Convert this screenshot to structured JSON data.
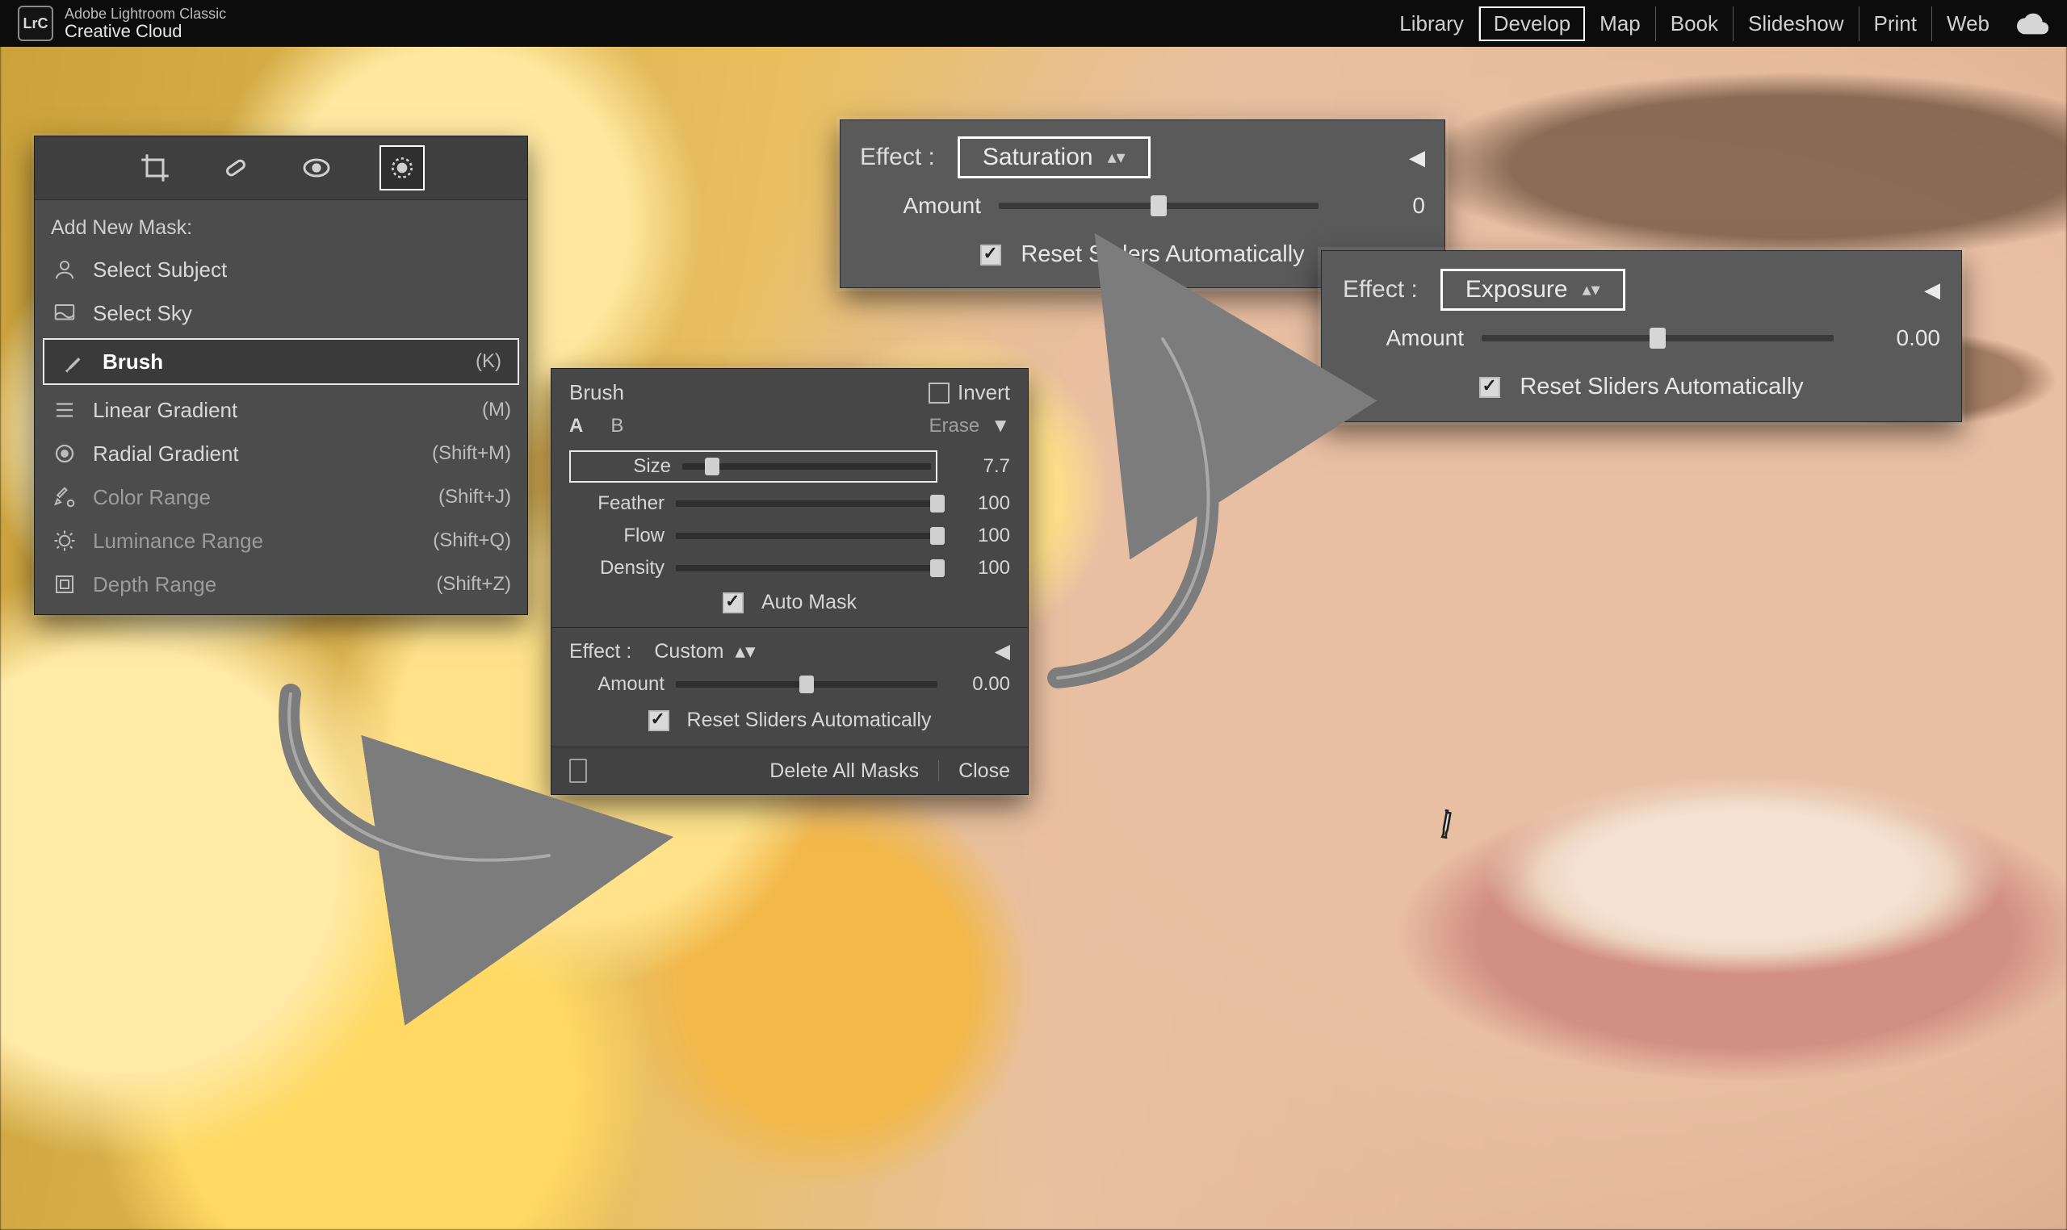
{
  "app": {
    "badge": "LrC",
    "title_line1": "Adobe Lightroom Classic",
    "title_line2": "Creative Cloud"
  },
  "modules": {
    "items": [
      "Library",
      "Develop",
      "Map",
      "Book",
      "Slideshow",
      "Print",
      "Web"
    ],
    "active": "Develop"
  },
  "mask_panel": {
    "header": "Add New Mask:",
    "rows": [
      {
        "icon": "person-icon",
        "label": "Select Subject",
        "shortcut": "",
        "dim": false
      },
      {
        "icon": "sky-icon",
        "label": "Select Sky",
        "shortcut": "",
        "dim": false
      },
      {
        "icon": "brush-icon",
        "label": "Brush",
        "shortcut": "(K)",
        "dim": false,
        "selected": true
      },
      {
        "icon": "linear-icon",
        "label": "Linear Gradient",
        "shortcut": "(M)",
        "dim": false
      },
      {
        "icon": "radial-icon",
        "label": "Radial Gradient",
        "shortcut": "(Shift+M)",
        "dim": false
      },
      {
        "icon": "colorrange-icon",
        "label": "Color Range",
        "shortcut": "(Shift+J)",
        "dim": true
      },
      {
        "icon": "lumrange-icon",
        "label": "Luminance Range",
        "shortcut": "(Shift+Q)",
        "dim": true
      },
      {
        "icon": "depth-icon",
        "label": "Depth Range",
        "shortcut": "(Shift+Z)",
        "dim": true
      }
    ]
  },
  "brush_panel": {
    "title": "Brush",
    "invert_label": "Invert",
    "invert_checked": false,
    "tab_a": "A",
    "tab_b": "B",
    "erase_label": "Erase",
    "sliders": {
      "size": {
        "label": "Size",
        "value": "7.7",
        "pct": 12
      },
      "feather": {
        "label": "Feather",
        "value": "100",
        "pct": 100
      },
      "flow": {
        "label": "Flow",
        "value": "100",
        "pct": 100
      },
      "density": {
        "label": "Density",
        "value": "100",
        "pct": 100
      }
    },
    "auto_mask_label": "Auto Mask",
    "auto_mask_checked": true,
    "effect_label": "Effect :",
    "effect_value": "Custom",
    "amount_label": "Amount",
    "amount_value": "0.00",
    "amount_pct": 50,
    "reset_label": "Reset Sliders Automatically",
    "reset_checked": true,
    "footer": {
      "delete_all": "Delete All Masks",
      "close": "Close"
    }
  },
  "fx_saturation": {
    "effect_label": "Effect :",
    "dropdown": "Saturation",
    "amount_label": "Amount",
    "amount_value": "0",
    "amount_pct": 50,
    "reset_label": "Reset Sliders Automatically",
    "reset_checked": true
  },
  "fx_exposure": {
    "effect_label": "Effect :",
    "dropdown": "Exposure",
    "amount_label": "Amount",
    "amount_value": "0.00",
    "amount_pct": 50,
    "reset_label": "Reset Sliders Automatically",
    "reset_checked": true
  }
}
